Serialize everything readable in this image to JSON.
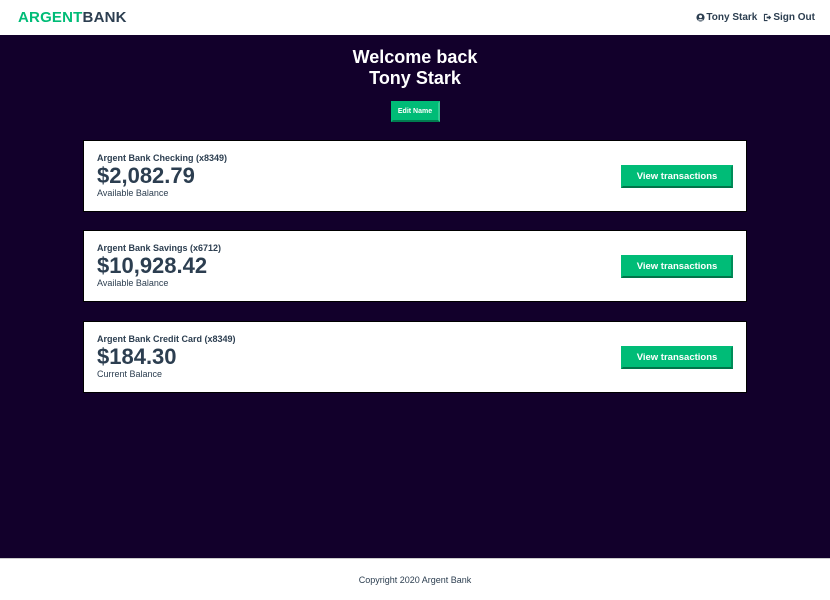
{
  "nav": {
    "logo_part1": "ARGENT",
    "logo_part2": "BANK",
    "user_name": "Tony Stark",
    "sign_out": "Sign Out",
    "user_icon": "user-circle-icon",
    "sign_out_icon": "sign-out-icon"
  },
  "header": {
    "line1": "Welcome back",
    "line2": "Tony Stark",
    "edit_button": "Edit Name"
  },
  "accounts": [
    {
      "title": "Argent Bank Checking (x8349)",
      "amount": "$2,082.79",
      "description": "Available Balance",
      "button": "View transactions"
    },
    {
      "title": "Argent Bank Savings (x6712)",
      "amount": "$10,928.42",
      "description": "Available Balance",
      "button": "View transactions"
    },
    {
      "title": "Argent Bank Credit Card (x8349)",
      "amount": "$184.30",
      "description": "Current Balance",
      "button": "View transactions"
    }
  ],
  "footer": {
    "copyright": "Copyright 2020 Argent Bank"
  },
  "colors": {
    "accent": "#00bc77",
    "background": "#12002b",
    "text": "#2c3e50"
  }
}
